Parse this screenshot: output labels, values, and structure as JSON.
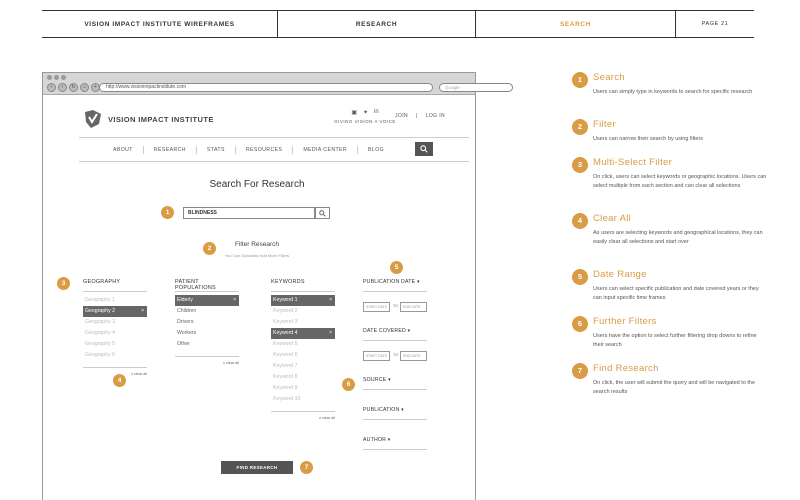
{
  "header": {
    "project": "VISION IMPACT INSTITUTE WIREFRAMES",
    "section": "RESEARCH",
    "current": "SEARCH",
    "page": "PAGE 21"
  },
  "browser": {
    "url": "http://www.visionimpactinstitute.com",
    "search_placeholder": "Google"
  },
  "site": {
    "logo_text": "VISION IMPACT INSTITUTE",
    "tagline": "GIVING VISION A VOICE",
    "join": "JOIN",
    "login": "LOG IN",
    "nav": [
      "ABOUT",
      "RESEARCH",
      "STATS",
      "RESOURCES",
      "MEDIA CENTER",
      "BLOG"
    ]
  },
  "search": {
    "title": "Search For Research",
    "value": "BLINDNESS",
    "filter_title": "Filter Research",
    "filter_sub": "You Can Optionally Add More Filters"
  },
  "filters": {
    "geography": {
      "label": "GEOGRAPHY",
      "items": [
        "Geography 1",
        "Geography 2",
        "Geography 3",
        "Geography 4",
        "Geography 5",
        "Geography 6"
      ],
      "selected": [
        1
      ],
      "clear": "x clear all"
    },
    "patients": {
      "label": "PATIENT POPULATIONS",
      "items": [
        "Elderly",
        "Children",
        "Drivers",
        "Workers",
        "Other"
      ],
      "selected": [
        0
      ],
      "clear": "x clear all"
    },
    "keywords": {
      "label": "KEYWORDS",
      "items": [
        "Keyword 1",
        "Keyword 2",
        "Keyword 3",
        "Keyword 4",
        "Keyword 5",
        "Keyword 6",
        "Keyword 7",
        "Keyword 8",
        "Keyword 9",
        "Keyword 10"
      ],
      "selected": [
        0,
        3
      ],
      "clear": "x clear all"
    },
    "publication_date": "PUBLICATION DATE",
    "date_covered": "DATE COVERED",
    "start_date": "START DATE",
    "end_date": "END DATE",
    "to": "TO",
    "source": "SOURCE",
    "publication": "PUBLICATION",
    "author": "AUTHOR",
    "find_button": "FIND RESEARCH"
  },
  "annotations": [
    {
      "num": "1",
      "title": "Search",
      "desc": "Users can simply type in keywords to search for specific research"
    },
    {
      "num": "2",
      "title": "Filter",
      "desc": "Users can narrow their search by using filters"
    },
    {
      "num": "3",
      "title": "Multi-Select Filter",
      "desc": "On click, users can select keywords or geographic locations. Users can select multiple from each section and can clear all selections"
    },
    {
      "num": "4",
      "title": "Clear All",
      "desc": "As users are selecting keywords and geographical locations, they can easily clear all selections and start over"
    },
    {
      "num": "5",
      "title": "Date Range",
      "desc": "Users can select specific publication and date covered years or they can input specific time frames"
    },
    {
      "num": "6",
      "title": "Further Filters",
      "desc": "Users have the option to select further filtering drop downs to refine their search"
    },
    {
      "num": "7",
      "title": "Find Research",
      "desc": "On click, the user will submit the query and will be navigated to the search results"
    }
  ],
  "colors": {
    "accent": "#d99b44",
    "dark": "#555555"
  }
}
